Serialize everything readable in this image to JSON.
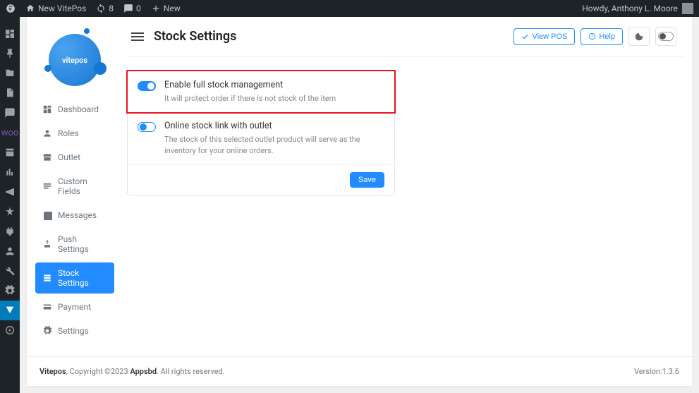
{
  "wp_bar": {
    "site_name": "New VitePos",
    "updates": "8",
    "comments": "0",
    "new": "New",
    "howdy": "Howdy, Anthony L. Moore"
  },
  "sidebar": {
    "items": [
      {
        "id": "dashboard",
        "label": "Dashboard"
      },
      {
        "id": "roles",
        "label": "Roles"
      },
      {
        "id": "outlet",
        "label": "Outlet"
      },
      {
        "id": "custom-fields",
        "label": "Custom Fields"
      },
      {
        "id": "messages",
        "label": "Messages"
      },
      {
        "id": "push-settings",
        "label": "Push Settings"
      },
      {
        "id": "stock-settings",
        "label": "Stock Settings"
      },
      {
        "id": "payment",
        "label": "Payment"
      },
      {
        "id": "settings",
        "label": "Settings"
      }
    ]
  },
  "header": {
    "title": "Stock Settings",
    "view_pos": "View POS",
    "help": "Help"
  },
  "settings": {
    "row1": {
      "title": "Enable full stock management",
      "desc": "It will protect order if there is not stock of the item"
    },
    "row2": {
      "title": "Online stock link with outlet",
      "desc": "The stock of this selected outlet product will serve as the inventory for your online orders."
    },
    "save": "Save"
  },
  "footer": {
    "brand1": "Vitepos",
    "mid": ", Copyright ©2023 ",
    "brand2": "Appsbd",
    "rights": ". All rights reserved.",
    "version_label": "Version:",
    "version": "1.3.6"
  }
}
